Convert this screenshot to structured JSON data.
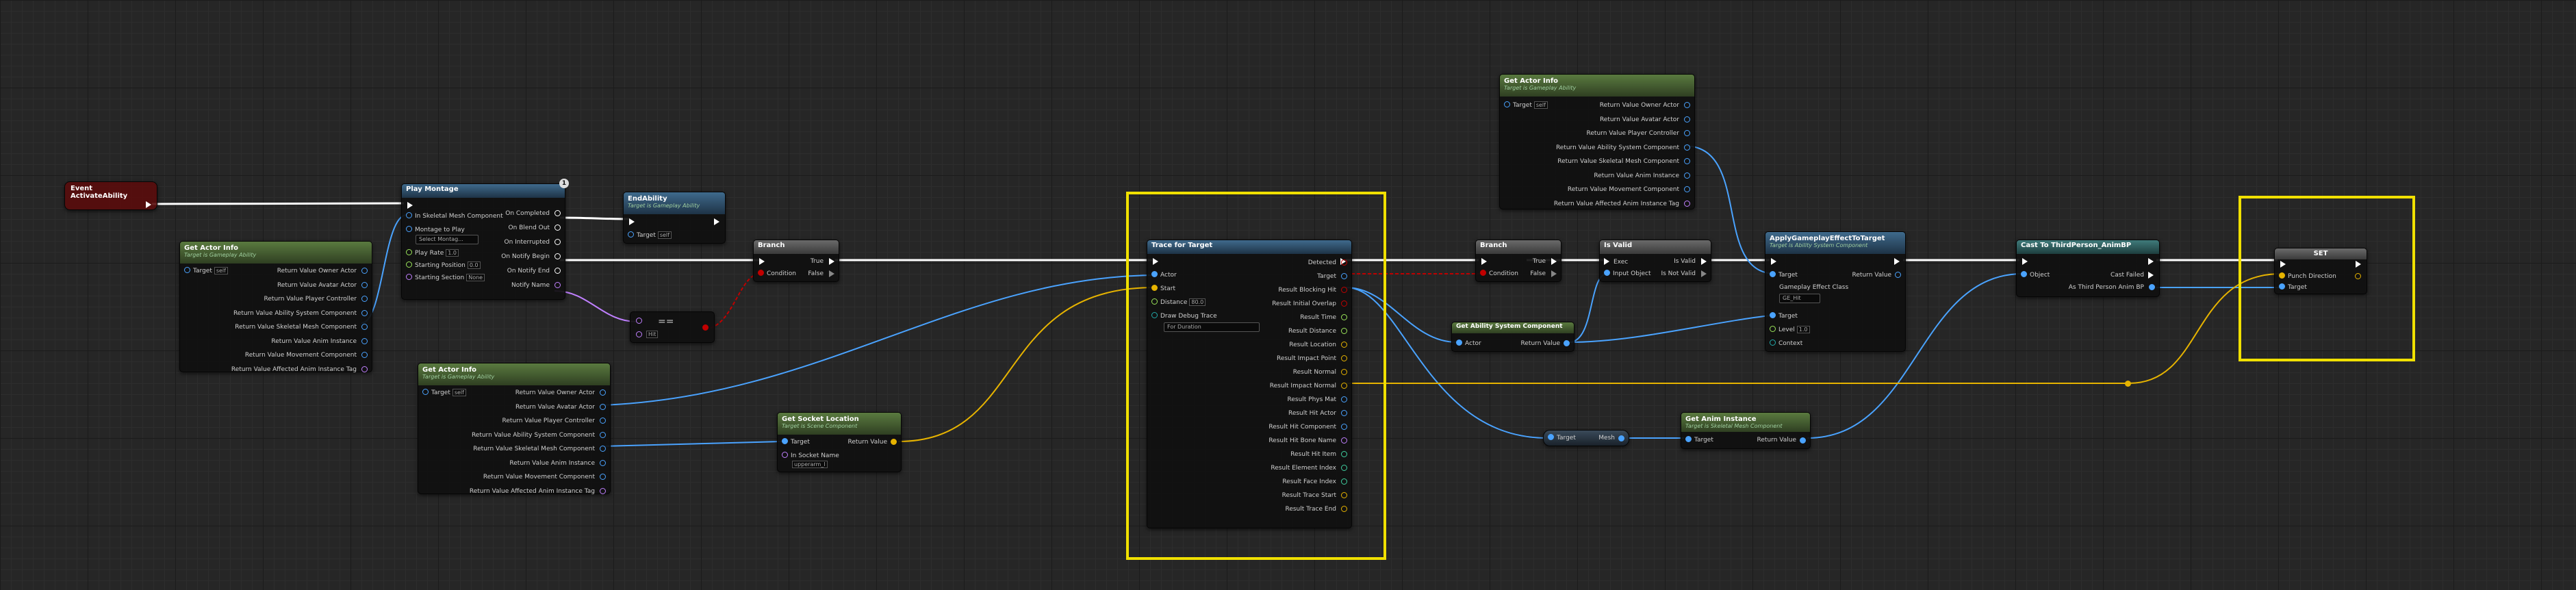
{
  "nodes": {
    "event": {
      "title": "Event ActivateAbility"
    },
    "gai1": {
      "title": "Get Actor Info",
      "subtitle": "Target is Gameplay Ability",
      "target": "Target",
      "target_val": "self",
      "outputs": [
        "Return Value Owner Actor",
        "Return Value Avatar Actor",
        "Return Value Player Controller",
        "Return Value Ability System Component",
        "Return Value Skeletal Mesh Component",
        "Return Value Anim Instance",
        "Return Value Movement Component",
        "Return Value Affected Anim Instance Tag"
      ]
    },
    "montage": {
      "title": "Play Montage",
      "badge": "1",
      "in_mesh": "In Skeletal Mesh Component",
      "montage_to_play": "Montage to Play",
      "montage_val": "Select Montag...",
      "play_rate": "Play Rate",
      "play_rate_val": "1.0",
      "starting_position": "Starting Position",
      "starting_position_val": "0.0",
      "starting_section": "Starting Section",
      "starting_section_val": "None",
      "outputs": [
        "On Completed",
        "On Blend Out",
        "On Interrupted",
        "On Notify Begin",
        "On Notify End",
        "Notify Name"
      ]
    },
    "endability": {
      "title": "EndAbility",
      "subtitle": "Target is Gameplay Ability",
      "target": "Target",
      "target_val": "self"
    },
    "eq": {
      "label": "=="
    },
    "eq_val": {
      "label": "Hit"
    },
    "gai2": {
      "title": "Get Actor Info",
      "subtitle": "Target is Gameplay Ability",
      "target": "Target",
      "target_val": "self",
      "outputs": [
        "Return Value Owner Actor",
        "Return Value Avatar Actor",
        "Return Value Player Controller",
        "Return Value Ability System Component",
        "Return Value Skeletal Mesh Component",
        "Return Value Anim Instance",
        "Return Value Movement Component",
        "Return Value Affected Anim Instance Tag"
      ]
    },
    "branch1": {
      "title": "Branch",
      "condition": "Condition",
      "true_label": "True",
      "false_label": "False"
    },
    "socket": {
      "title": "Get Socket Location",
      "subtitle": "Target is Scene Component",
      "target": "Target",
      "in_socket": "In Socket Name",
      "in_socket_val": "upperarm_l",
      "return_value": "Return Value"
    },
    "trace": {
      "title": "Trace for Target",
      "actor": "Actor",
      "start": "Start",
      "distance": "Distance",
      "distance_val": "80.0",
      "draw_debug": "Draw Debug Trace",
      "draw_debug_val": "For Duration",
      "outputs": [
        "Detected",
        "Target",
        "Result Blocking Hit",
        "Result Initial Overlap",
        "Result Time",
        "Result Distance",
        "Result Location",
        "Result Impact Point",
        "Result Normal",
        "Result Impact Normal",
        "Result Phys Mat",
        "Result Hit Actor",
        "Result Hit Component",
        "Result Hit Bone Name",
        "Result Hit Item",
        "Result Element Index",
        "Result Face Index",
        "Result Trace Start",
        "Result Trace End"
      ]
    },
    "branch2": {
      "title": "Branch",
      "condition": "Condition",
      "true_label": "True",
      "false_label": "False"
    },
    "isvalid": {
      "title": "Is Valid",
      "exec": "Exec",
      "input_object": "Input Object",
      "is_valid": "Is Valid",
      "is_not_valid": "Is Not Valid"
    },
    "gai3": {
      "title": "Get Actor Info",
      "subtitle": "Target is Gameplay Ability",
      "target": "Target",
      "target_val": "self",
      "outputs": [
        "Return Value Owner Actor",
        "Return Value Avatar Actor",
        "Return Value Player Controller",
        "Return Value Ability System Component",
        "Return Value Skeletal Mesh Component",
        "Return Value Anim Instance",
        "Return Value Movement Component",
        "Return Value Affected Anim Instance Tag"
      ]
    },
    "getasc": {
      "title": "Get Ability System Component",
      "actor": "Actor",
      "return_value": "Return Value"
    },
    "apply": {
      "title": "ApplyGameplayEffectToTarget",
      "subtitle": "Target is Ability System Component",
      "target": "Target",
      "return_value": "Return Value",
      "effect_class": "Gameplay Effect Class",
      "effect_val": "GE_Hit",
      "target2": "Target",
      "level": "Level",
      "level_val": "1.0",
      "context": "Context"
    },
    "cast": {
      "title": "Cast To ThirdPerson_AnimBP",
      "object": "Object",
      "cast_failed": "Cast Failed",
      "as": "As Third Person Anim BP"
    },
    "set": {
      "title": "SET",
      "punch_direction": "Punch Direction",
      "target": "Target"
    },
    "mesh": {
      "target": "Target",
      "mesh": "Mesh"
    },
    "animinst": {
      "title": "Get Anim Instance",
      "subtitle": "Target is Skeletal Mesh Component",
      "target": "Target",
      "return_value": "Return Value"
    }
  }
}
